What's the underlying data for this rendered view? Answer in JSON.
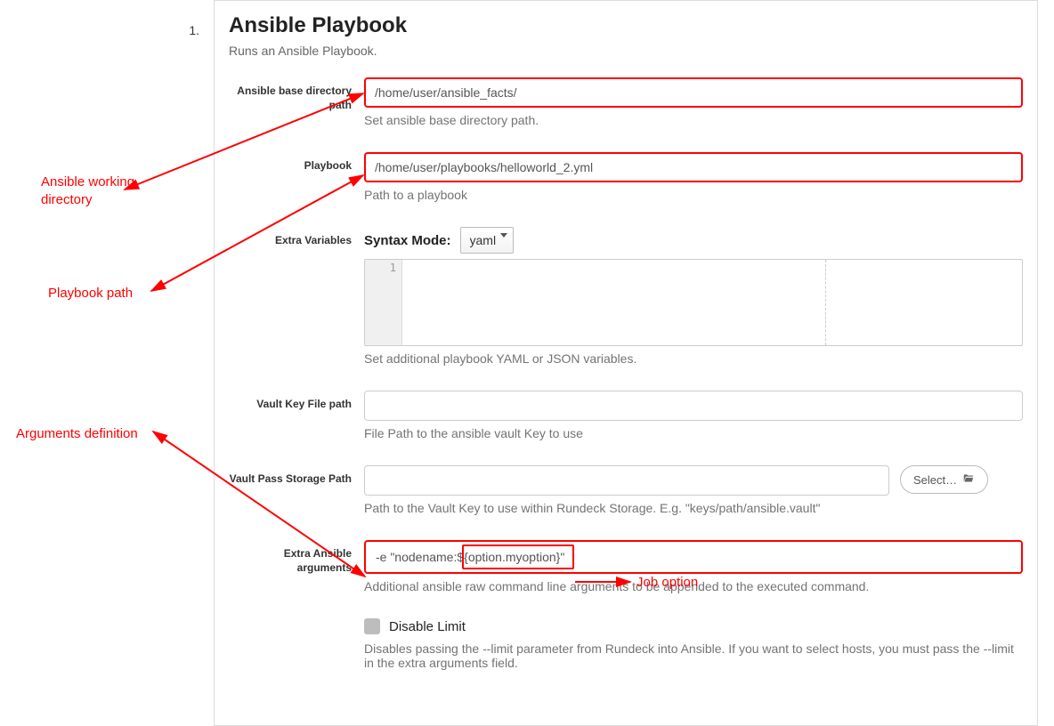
{
  "step_number": "1.",
  "section_title": "Ansible Playbook",
  "section_subtitle": "Runs an Ansible Playbook.",
  "fields": {
    "base_dir": {
      "label": "Ansible base directory path",
      "value": "/home/user/ansible_facts/",
      "help": "Set ansible base directory path."
    },
    "playbook": {
      "label": "Playbook",
      "value": "/home/user/playbooks/helloworld_2.yml",
      "help": "Path to a playbook"
    },
    "extra_vars": {
      "label": "Extra Variables",
      "syntax_mode_label": "Syntax Mode:",
      "syntax_mode_value": "yaml",
      "gutter_line": "1",
      "help": "Set additional playbook YAML or JSON variables."
    },
    "vault_key": {
      "label": "Vault Key File path",
      "value": "",
      "help": "File Path to the ansible vault Key to use"
    },
    "vault_pass": {
      "label": "Vault Pass Storage Path",
      "value": "",
      "select_button": "Select…",
      "help": "Path to the Vault Key to use within Rundeck Storage. E.g. \"keys/path/ansible.vault\""
    },
    "extra_args": {
      "label": "Extra Ansible arguments",
      "value": "-e \"nodename:${option.myoption}\"",
      "help": "Additional ansible raw command line arguments to be appended to the executed command."
    },
    "disable_limit": {
      "label": "Disable Limit",
      "help": "Disables passing the --limit parameter from Rundeck into Ansible. If you want to select hosts, you must pass the --limit in the extra arguments field."
    }
  },
  "annotations": {
    "working_dir": "Ansible working directory",
    "playbook_path": "Playbook path",
    "arguments_def": "Arguments definition",
    "job_option": "Job option"
  }
}
